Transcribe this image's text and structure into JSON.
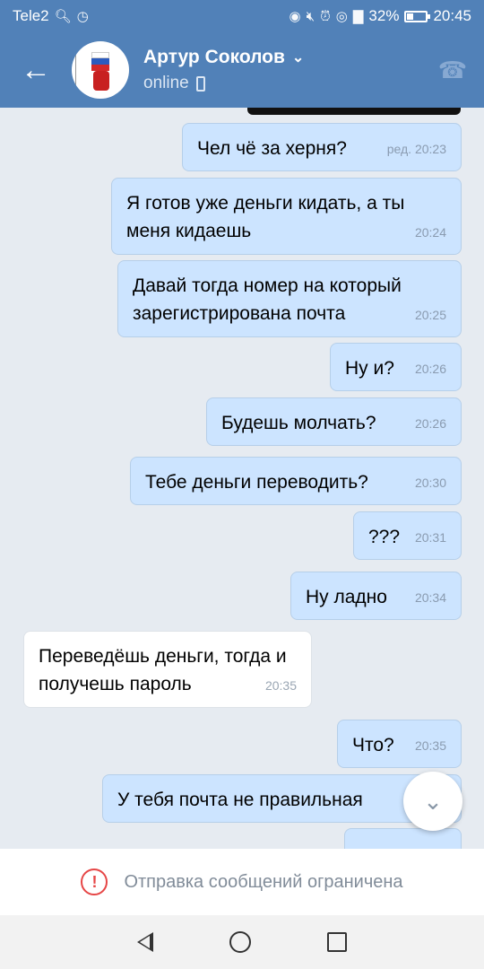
{
  "status_bar": {
    "carrier": "Tele2",
    "battery": "32%",
    "time": "20:45"
  },
  "header": {
    "back_icon": "arrow-left-icon",
    "name": "Артур Соколов",
    "status": "online",
    "call_icon": "phone-icon"
  },
  "messages": [
    {
      "dir": "out",
      "text": "Чел чё за херня?",
      "time": "ред. 20:23"
    },
    {
      "dir": "out",
      "text": "Я готов уже деньги кидать, а ты меня кидаешь",
      "time": "20:24"
    },
    {
      "dir": "out",
      "text": "Давай тогда номер на который зарегистрирована почта",
      "time": "20:25"
    },
    {
      "dir": "out",
      "text": "Ну и?",
      "time": "20:26"
    },
    {
      "dir": "out",
      "text": "Будешь молчать?",
      "time": "20:26"
    },
    {
      "dir": "out",
      "text": "Тебе деньги переводить?",
      "time": "20:30"
    },
    {
      "dir": "out",
      "text": "???",
      "time": "20:31"
    },
    {
      "dir": "out",
      "text": "Ну ладно",
      "time": "20:34"
    },
    {
      "dir": "in",
      "text": "Переведёшь деньги, тогда и получешь пароль",
      "time": "20:35"
    },
    {
      "dir": "out",
      "text": "Что?",
      "time": "20:35"
    },
    {
      "dir": "out",
      "text": "У тебя почта не правильная",
      "time": ""
    }
  ],
  "footer": {
    "restricted_text": "Отправка сообщений ограничена"
  },
  "colors": {
    "header_bg": "#5181b8",
    "out_bubble": "#cce4ff",
    "in_bubble": "#ffffff",
    "alert": "#e64646"
  }
}
